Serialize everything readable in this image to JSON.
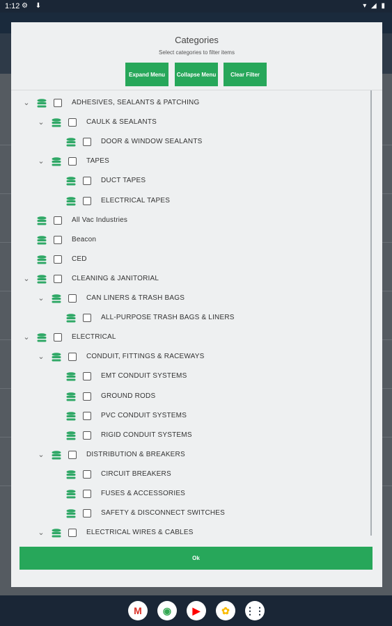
{
  "status_bar": {
    "time": "1:12",
    "left_icons": [
      "settings-icon",
      "download-icon"
    ],
    "right_icons": [
      "wifi-icon",
      "signal-icon",
      "battery-icon"
    ]
  },
  "dialog": {
    "title": "Categories",
    "subtitle": "Select categories to filter items",
    "buttons": {
      "expand": "Expand Menu",
      "collapse": "Collapse Menu",
      "clear": "Clear Filter"
    },
    "ok_label": "Ok",
    "tree": [
      {
        "label": "ADHESIVES, SEALANTS & PATCHING",
        "level": 0,
        "expandable": true
      },
      {
        "label": "CAULK & SEALANTS",
        "level": 1,
        "expandable": true
      },
      {
        "label": "DOOR & WINDOW SEALANTS",
        "level": 2,
        "expandable": false
      },
      {
        "label": "TAPES",
        "level": 1,
        "expandable": true
      },
      {
        "label": "DUCT TAPES",
        "level": 2,
        "expandable": false
      },
      {
        "label": "ELECTRICAL TAPES",
        "level": 2,
        "expandable": false
      },
      {
        "label": "All Vac Industries",
        "level": 0,
        "expandable": false
      },
      {
        "label": "Beacon",
        "level": 0,
        "expandable": false
      },
      {
        "label": "CED",
        "level": 0,
        "expandable": false
      },
      {
        "label": "CLEANING & JANITORIAL",
        "level": 0,
        "expandable": true
      },
      {
        "label": "CAN LINERS & TRASH BAGS",
        "level": 1,
        "expandable": true
      },
      {
        "label": "ALL-PURPOSE TRASH BAGS & LINERS",
        "level": 2,
        "expandable": false
      },
      {
        "label": "ELECTRICAL",
        "level": 0,
        "expandable": true
      },
      {
        "label": "CONDUIT, FITTINGS & RACEWAYS",
        "level": 1,
        "expandable": true
      },
      {
        "label": "EMT CONDUIT SYSTEMS",
        "level": 2,
        "expandable": false
      },
      {
        "label": "GROUND RODS",
        "level": 2,
        "expandable": false
      },
      {
        "label": "PVC CONDUIT SYSTEMS",
        "level": 2,
        "expandable": false
      },
      {
        "label": "RIGID CONDUIT SYSTEMS",
        "level": 2,
        "expandable": false
      },
      {
        "label": "DISTRIBUTION & BREAKERS",
        "level": 1,
        "expandable": true
      },
      {
        "label": "CIRCUIT BREAKERS",
        "level": 2,
        "expandable": false
      },
      {
        "label": "FUSES & ACCESSORIES",
        "level": 2,
        "expandable": false
      },
      {
        "label": "SAFETY & DISCONNECT SWITCHES",
        "level": 2,
        "expandable": false
      },
      {
        "label": "ELECTRICAL WIRES & CABLES",
        "level": 1,
        "expandable": true
      }
    ]
  },
  "colors": {
    "accent": "#27a75a",
    "dialog_bg": "#eef0f1",
    "icon_green": "#2fa866"
  },
  "dock": [
    {
      "name": "gmail-icon",
      "glyph": "M",
      "color": "#d93025"
    },
    {
      "name": "chrome-icon",
      "glyph": "◉",
      "color": "#34a853"
    },
    {
      "name": "youtube-icon",
      "glyph": "▶",
      "color": "#ff0000"
    },
    {
      "name": "photos-icon",
      "glyph": "✿",
      "color": "#fbbc04"
    },
    {
      "name": "apps-icon",
      "glyph": "⋮⋮",
      "color": "#1a2636"
    }
  ]
}
